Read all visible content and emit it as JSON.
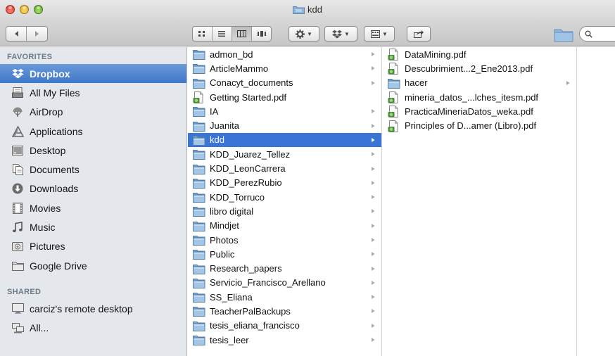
{
  "window": {
    "title": "kdd",
    "title_icon": "folder-icon"
  },
  "toolbar": {
    "nav": [
      "back-icon",
      "forward-icon"
    ],
    "view_modes": [
      "icon-view-icon",
      "list-view-icon",
      "column-view-icon",
      "coverflow-view-icon"
    ],
    "active_view": "column-view-icon",
    "action_menu": "gear-icon",
    "dropbox_menu": "dropbox-icon",
    "arrange_menu": "arrange-icon",
    "share": "share-icon",
    "search": "search-icon"
  },
  "sidebar": {
    "favorites_header": "FAVORITES",
    "favorites": [
      {
        "label": "Dropbox",
        "icon": "dropbox-icon",
        "selected": true
      },
      {
        "label": "All My Files",
        "icon": "all-files-icon"
      },
      {
        "label": "AirDrop",
        "icon": "airdrop-icon"
      },
      {
        "label": "Applications",
        "icon": "applications-icon"
      },
      {
        "label": "Desktop",
        "icon": "desktop-icon"
      },
      {
        "label": "Documents",
        "icon": "documents-icon"
      },
      {
        "label": "Downloads",
        "icon": "downloads-icon"
      },
      {
        "label": "Movies",
        "icon": "movies-icon"
      },
      {
        "label": "Music",
        "icon": "music-icon"
      },
      {
        "label": "Pictures",
        "icon": "pictures-icon"
      },
      {
        "label": "Google Drive",
        "icon": "folder-icon"
      }
    ],
    "shared_header": "SHARED",
    "shared": [
      {
        "label": "carciz's remote desktop",
        "icon": "display-icon"
      },
      {
        "label": "All...",
        "icon": "network-icon"
      }
    ]
  },
  "columns": {
    "col1": [
      {
        "name": "admon_bd",
        "kind": "folder"
      },
      {
        "name": "ArticleMammo",
        "kind": "folder"
      },
      {
        "name": "Conacyt_documents",
        "kind": "folder"
      },
      {
        "name": "Getting Started.pdf",
        "kind": "pdf"
      },
      {
        "name": "IA",
        "kind": "folder"
      },
      {
        "name": "Juanita",
        "kind": "folder"
      },
      {
        "name": "kdd",
        "kind": "folder",
        "selected": true
      },
      {
        "name": "KDD_Juarez_Tellez",
        "kind": "folder"
      },
      {
        "name": "KDD_LeonCarrera",
        "kind": "folder"
      },
      {
        "name": "KDD_PerezRubio",
        "kind": "folder"
      },
      {
        "name": "KDD_Torruco",
        "kind": "folder"
      },
      {
        "name": "libro digital",
        "kind": "folder"
      },
      {
        "name": "Mindjet",
        "kind": "folder"
      },
      {
        "name": "Photos",
        "kind": "folder"
      },
      {
        "name": "Public",
        "kind": "folder"
      },
      {
        "name": "Research_papers",
        "kind": "folder"
      },
      {
        "name": "Servicio_Francisco_Arellano",
        "kind": "folder"
      },
      {
        "name": "SS_Eliana",
        "kind": "folder"
      },
      {
        "name": "TeacherPalBackups",
        "kind": "folder"
      },
      {
        "name": "tesis_eliana_francisco",
        "kind": "folder"
      },
      {
        "name": "tesis_leer",
        "kind": "folder"
      }
    ],
    "col2": [
      {
        "name": "DataMining.pdf",
        "kind": "pdf"
      },
      {
        "name": "Descubrimient...2_Ene2013.pdf",
        "kind": "pdf"
      },
      {
        "name": "hacer",
        "kind": "folder"
      },
      {
        "name": "mineria_datos_...lches_itesm.pdf",
        "kind": "pdf"
      },
      {
        "name": "PracticaMineriaDatos_weka.pdf",
        "kind": "pdf"
      },
      {
        "name": "Principles of D...amer (Libro).pdf",
        "kind": "pdf"
      }
    ]
  },
  "colors": {
    "selection": "#3875d7",
    "sidebar_selection": "#4a83cf",
    "sidebar_bg": "#e4e8ed",
    "folder": "#8cb4d8"
  }
}
